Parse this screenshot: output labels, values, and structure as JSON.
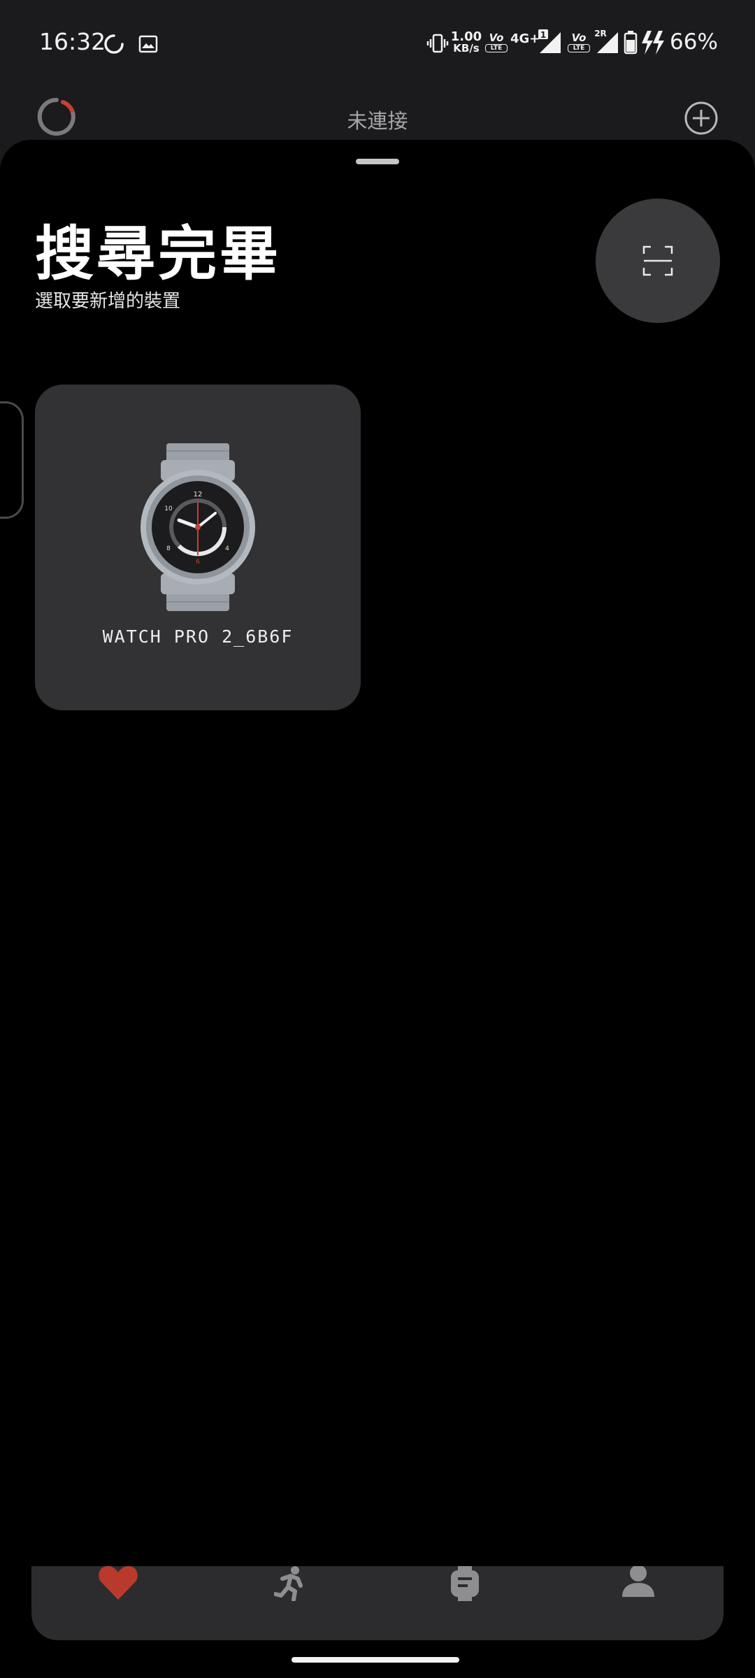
{
  "status_bar": {
    "time": "16:32",
    "net_speed_value": "1.00",
    "net_speed_unit": "KB/s",
    "sim1_network": "4G+",
    "sim1_badge": "1",
    "volte_label": "Vo",
    "lte_label": "LTE",
    "sim2_badge": "2R",
    "battery_percent": "66%"
  },
  "header": {
    "connection_status": "未連接"
  },
  "sheet": {
    "title": "搜尋完畢",
    "subtitle": "選取要新增的裝置"
  },
  "devices": [
    {
      "name": "WATCH PRO 2_6B6F"
    }
  ],
  "watch_face": {
    "numbers": [
      "12",
      "10",
      "8",
      "6",
      "4"
    ]
  },
  "bottom_nav": {
    "items": [
      {
        "icon": "heart-icon",
        "active": true
      },
      {
        "icon": "running-icon",
        "active": false
      },
      {
        "icon": "watch-icon",
        "active": false
      },
      {
        "icon": "person-icon",
        "active": false
      }
    ]
  },
  "colors": {
    "accent_red": "#b93a2c",
    "card_bg": "#323234",
    "nav_bg": "#2c2c2e",
    "header_bg": "#1b1b1d"
  }
}
